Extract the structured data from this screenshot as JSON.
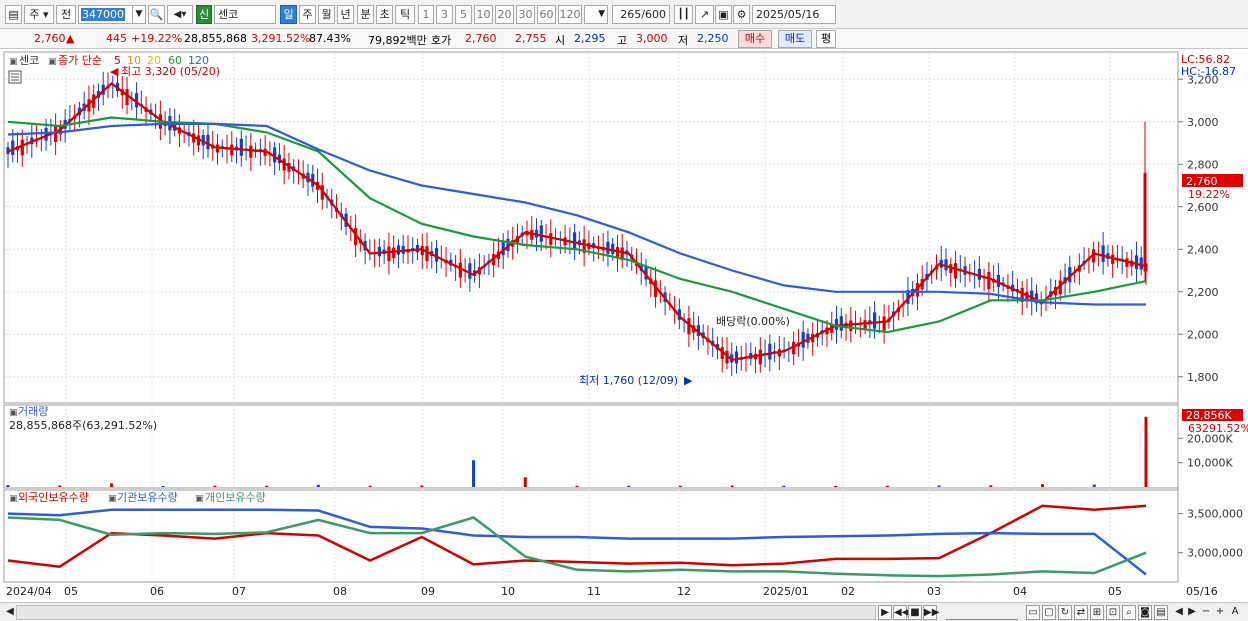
{
  "toolbar": {
    "market_btn": "주",
    "all_btn": "전",
    "code": "347000",
    "new_badge": "신",
    "name": "센코",
    "periods": [
      "일",
      "주",
      "월",
      "년",
      "분",
      "초",
      "틱"
    ],
    "active_period": "일",
    "intervals": [
      "1",
      "3",
      "5",
      "10",
      "20",
      "30",
      "60",
      "120"
    ],
    "count": "265",
    "count_max": "/600",
    "date": "2025/05/16"
  },
  "quote": {
    "price": "2,760",
    "change": "445",
    "change_pct": "+19.22%",
    "volume": "28,855,868",
    "volume_pct": "3,291.52%",
    "turnover_pct": "87.43%",
    "amount": "79,892백만",
    "bid_label": "호가",
    "ask": "2,760",
    "bid": "2,755",
    "open_label": "시",
    "open": "2,295",
    "high_label": "고",
    "high": "3,000",
    "low_label": "저",
    "low": "2,250",
    "buy_btn": "매수",
    "sell_btn": "매도",
    "eval_btn": "평"
  },
  "price_panel": {
    "stock_label": "센코",
    "ma_title": "종가 단순",
    "ma_periods": [
      "5",
      "10",
      "20",
      "60",
      "120"
    ],
    "ma_colors": [
      "#d40000",
      "#ff8c00",
      "#e6d800",
      "#1a9a3a",
      "#2e5be0"
    ],
    "high_annotation": "최고 3,320 (05/20)",
    "low_annotation": "최저 1,760 (12/09)",
    "dividend_annotation": "배당락(0.00%)",
    "lc_label": "LC:56.82",
    "hc_label": "HC:-16.87",
    "y_ticks": [
      "3,200",
      "3,000",
      "2,800",
      "2,600",
      "2,400",
      "2,200",
      "2,000",
      "1,800"
    ],
    "current_price_tag": "2,760",
    "current_pct_tag": "19.22%"
  },
  "volume_panel": {
    "title": "거래량",
    "info": "28,855,868주(63,291.52%)",
    "y_ticks": [
      "20,000K",
      "10,000K"
    ],
    "current_tag": "28,856K",
    "current_pct": "63291.52%"
  },
  "holding_panel": {
    "series_labels": [
      "외국인보유수량",
      "기관보유수량",
      "개인보유수량"
    ],
    "series_colors": [
      "#d40000",
      "#2e5be0",
      "#3a9a6a"
    ],
    "y_ticks": [
      "3,500,000",
      "3,000,000"
    ]
  },
  "x_axis": {
    "labels": [
      "2024/04",
      "05",
      "06",
      "07",
      "08",
      "09",
      "10",
      "11",
      "12",
      "2025/01",
      "02",
      "03",
      "04",
      "05",
      "05/16"
    ]
  },
  "chart_data": [
    {
      "type": "line",
      "title": "",
      "series": [
        {
          "name": "5",
          "values": [
            2860,
            2960,
            3180,
            3000,
            2880,
            2860,
            2700,
            2380,
            2400,
            2280,
            2480,
            2430,
            2380,
            2080,
            1880,
            1920,
            2040,
            2060,
            2330,
            2260,
            2150,
            2380,
            2320
          ]
        },
        {
          "name": "60",
          "values": [
            3000,
            2980,
            3020,
            3000,
            2990,
            2950,
            2860,
            2640,
            2520,
            2460,
            2420,
            2400,
            2350,
            2260,
            2200,
            2120,
            2040,
            2010,
            2060,
            2160,
            2160,
            2200,
            2250
          ]
        },
        {
          "name": "120",
          "values": [
            2940,
            2950,
            2980,
            2990,
            2990,
            2980,
            2870,
            2770,
            2700,
            2660,
            2620,
            2560,
            2480,
            2380,
            2300,
            2230,
            2200,
            2200,
            2200,
            2190,
            2150,
            2140,
            2140
          ]
        }
      ],
      "ylim": [
        1700,
        3300
      ]
    },
    {
      "type": "bar",
      "title": "",
      "series": [
        {
          "name": "거래량",
          "values": [
            800,
            600,
            1500,
            400,
            500,
            500,
            900,
            500,
            600,
            11000,
            4000,
            500,
            500,
            500,
            600,
            500,
            400,
            500,
            600,
            700,
            1200,
            1000,
            28856
          ]
        }
      ],
      "ylim": [
        0,
        30000
      ]
    },
    {
      "type": "line",
      "title": "",
      "series": [
        {
          "name": "외국인보유수량",
          "values": [
            2900000,
            2820000,
            3250000,
            3220000,
            3180000,
            3250000,
            3220000,
            2900000,
            3200000,
            2850000,
            2900000,
            2880000,
            2860000,
            2870000,
            2840000,
            2860000,
            2920000,
            2920000,
            2930000,
            3250000,
            3600000,
            3550000,
            3600000
          ]
        },
        {
          "name": "기관보유수량",
          "values": [
            3500000,
            3480000,
            3550000,
            3550000,
            3550000,
            3550000,
            3540000,
            3330000,
            3310000,
            3220000,
            3200000,
            3200000,
            3180000,
            3180000,
            3180000,
            3200000,
            3210000,
            3220000,
            3240000,
            3250000,
            3240000,
            3240000,
            2720000
          ]
        },
        {
          "name": "개인보유수량",
          "values": [
            3450000,
            3420000,
            3230000,
            3250000,
            3240000,
            3260000,
            3420000,
            3250000,
            3250000,
            3450000,
            2950000,
            2780000,
            2760000,
            2780000,
            2760000,
            2760000,
            2730000,
            2710000,
            2700000,
            2720000,
            2760000,
            2740000,
            3000000
          ]
        }
      ],
      "ylim": [
        2650000,
        3700000
      ]
    }
  ]
}
